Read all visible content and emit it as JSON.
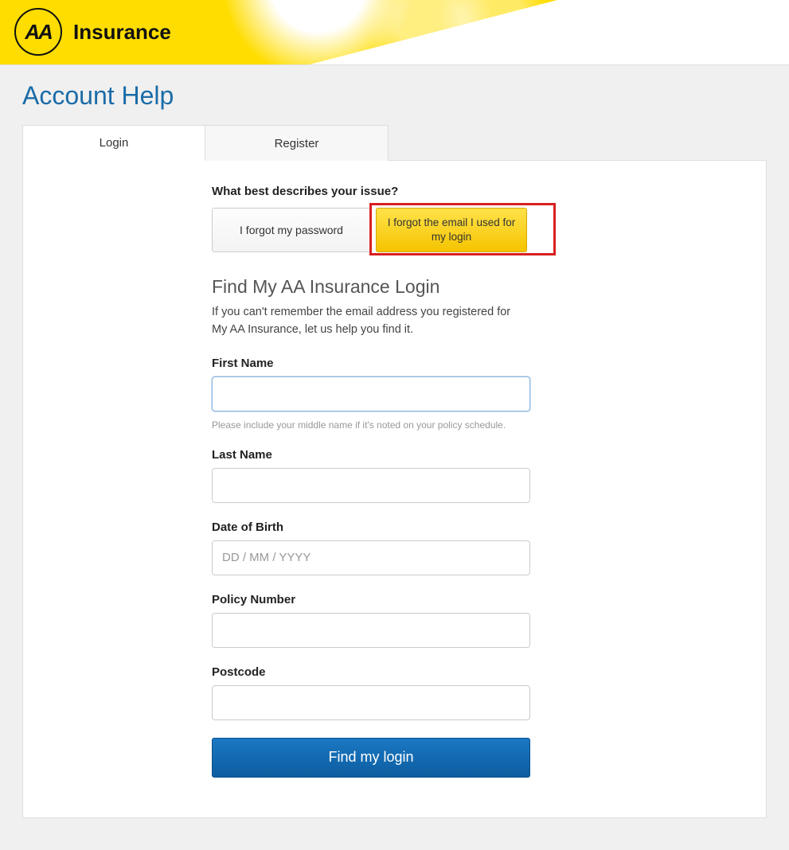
{
  "brand": {
    "logo_letters": "AA",
    "logo_word": "Insurance"
  },
  "page": {
    "title": "Account Help"
  },
  "tabs": {
    "login": "Login",
    "register": "Register"
  },
  "issue": {
    "question": "What best describes your issue?",
    "forgot_password": "I forgot my password",
    "forgot_email": "I forgot the email I used for my login"
  },
  "form": {
    "heading": "Find My AA Insurance Login",
    "description": "If you can't remember the email address you registered for My AA Insurance, let us help you find it.",
    "first_name_label": "First Name",
    "first_name_hint": "Please include your middle name if it's noted on your policy schedule.",
    "last_name_label": "Last Name",
    "dob_label": "Date of Birth",
    "dob_placeholder": "DD / MM / YYYY",
    "policy_label": "Policy Number",
    "postcode_label": "Postcode",
    "submit": "Find my login"
  }
}
